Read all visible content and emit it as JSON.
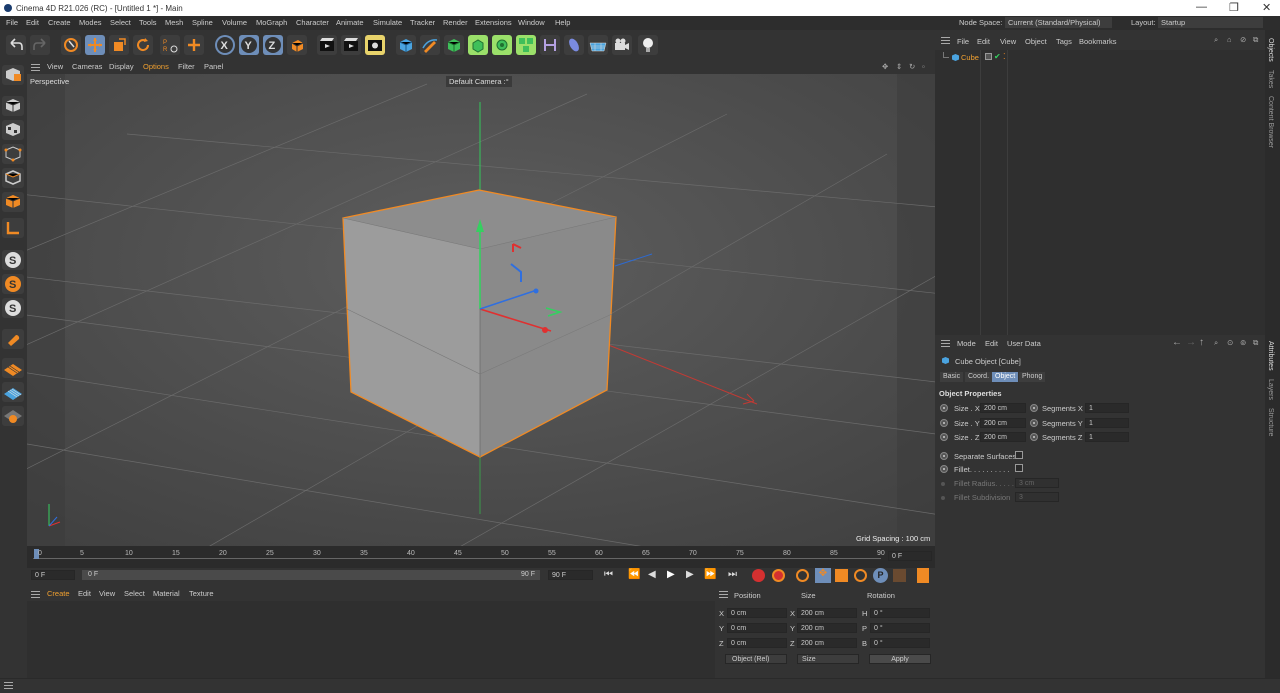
{
  "window": {
    "title": "Cinema 4D R21.026 (RC) - [Untitled 1 *] - Main",
    "controls": [
      "—",
      "❐",
      "✕"
    ]
  },
  "menu": [
    "File",
    "Edit",
    "Create",
    "Modes",
    "Select",
    "Tools",
    "Mesh",
    "Spline",
    "Volume",
    "MoGraph",
    "Character",
    "Animate",
    "Simulate",
    "Tracker",
    "Render",
    "Extensions",
    "Window",
    "Help"
  ],
  "nodespace": {
    "label": "Node Space:",
    "value": "Current (Standard/Physical)"
  },
  "layout": {
    "label": "Layout:",
    "value": "Startup"
  },
  "axis_buttons": [
    "X",
    "Y",
    "Z"
  ],
  "viewport": {
    "menu": [
      "View",
      "Cameras",
      "Display",
      "Options",
      "Filter",
      "Panel"
    ],
    "view_name": "Perspective",
    "camera": "Default Camera :°",
    "grid_spacing": "Grid Spacing : 100 cm"
  },
  "timeline": {
    "ticks": [
      "0",
      "5",
      "10",
      "15",
      "20",
      "25",
      "30",
      "35",
      "40",
      "45",
      "50",
      "55",
      "60",
      "65",
      "70",
      "75",
      "80",
      "85",
      "90"
    ],
    "current_frame": "0 F"
  },
  "transport": {
    "start": "0 F",
    "min": "0 F",
    "max_inner": "90 F",
    "end": "90 F"
  },
  "material_manager": {
    "menu": [
      "Create",
      "Edit",
      "View",
      "Select",
      "Material",
      "Texture"
    ]
  },
  "coord_manager": {
    "headers": [
      "Position",
      "Size",
      "Rotation"
    ],
    "rows": [
      {
        "pos_axis": "X",
        "pos": "0 cm",
        "size_axis": "X",
        "size": "200 cm",
        "rot_axis": "H",
        "rot": "0 °"
      },
      {
        "pos_axis": "Y",
        "pos": "0 cm",
        "size_axis": "Y",
        "size": "200 cm",
        "rot_axis": "P",
        "rot": "0 °"
      },
      {
        "pos_axis": "Z",
        "pos": "0 cm",
        "size_axis": "Z",
        "size": "200 cm",
        "rot_axis": "B",
        "rot": "0 °"
      }
    ],
    "mode_select": "Object (Rel)",
    "size_select": "Size",
    "apply": "Apply"
  },
  "object_manager": {
    "menu": [
      "File",
      "Edit",
      "View",
      "Object",
      "Tags",
      "Bookmarks"
    ],
    "objects": [
      {
        "name": "Cube"
      }
    ]
  },
  "attributes": {
    "menu": [
      "Mode",
      "Edit",
      "User Data"
    ],
    "title": "Cube Object [Cube]",
    "tabs": [
      "Basic",
      "Coord.",
      "Object",
      "Phong"
    ],
    "active_tab": "Object",
    "section": "Object Properties",
    "size": [
      {
        "label": "Size . X",
        "value": "200 cm"
      },
      {
        "label": "Size . Y",
        "value": "200 cm"
      },
      {
        "label": "Size . Z",
        "value": "200 cm"
      }
    ],
    "segments": [
      {
        "label": "Segments X",
        "value": "1"
      },
      {
        "label": "Segments Y",
        "value": "1"
      },
      {
        "label": "Segments Z",
        "value": "1"
      }
    ],
    "separate_surfaces": "Separate Surfaces",
    "fillet": "Fillet. . . . . . . . . .",
    "fillet_radius": {
      "label": "Fillet Radius. . . . .",
      "value": "3 cm"
    },
    "fillet_subdivision": {
      "label": "Fillet Subdivision",
      "value": "3"
    }
  },
  "side_tabs": [
    "Objects",
    "Takes",
    "Content Browser",
    "Attributes",
    "Layers",
    "Structure"
  ],
  "colors": {
    "accent": "#6e8eb9",
    "selection": "#f08a24",
    "x_axis": "#e0302a",
    "y_axis": "#30c05a",
    "z_axis": "#2f6fe0",
    "cube_icon": "#4aa3df"
  }
}
